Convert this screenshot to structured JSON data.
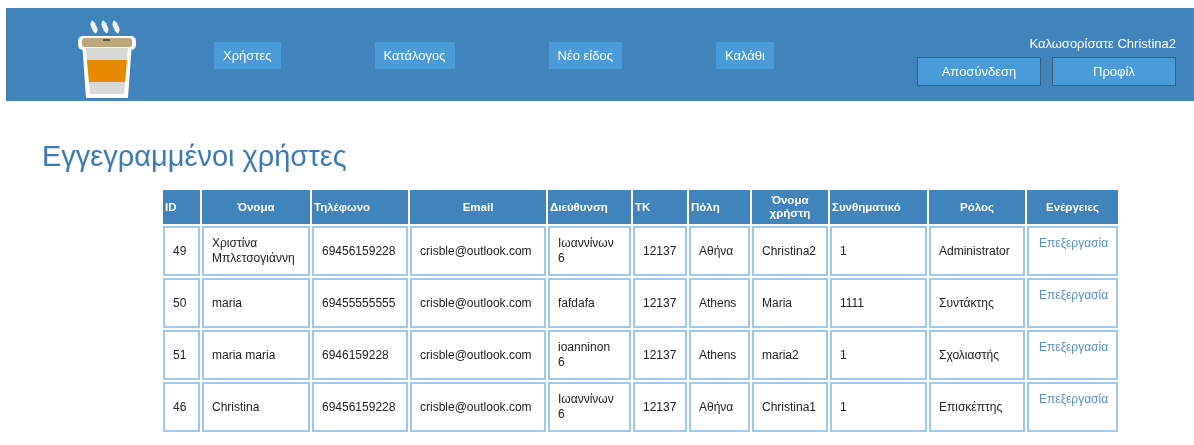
{
  "header": {
    "nav": [
      "Χρήστες",
      "Κατάλογος",
      "Νέο είδος",
      "Καλάθι"
    ],
    "welcome": "Καλωσορίσατε Christina2",
    "buttons": [
      "Αποσύνδεση",
      "Προφίλ"
    ]
  },
  "page_title": "Εγγεγραμμένοι χρήστες",
  "table": {
    "columns": [
      "ID",
      "Όνομα",
      "Τηλέφωνο",
      "Email",
      "Διεύθυνση",
      "ΤΚ",
      "Πόλη",
      "Όνομα χρήστη",
      "Συνθηματικό",
      "Ρόλος",
      "Ενέργειες"
    ],
    "rows": [
      {
        "cells": [
          "49",
          "Χριστίνα Μπλετσογιάννη",
          "69456159228",
          "crisble@outlook.com",
          "Ιωαννίνων 6",
          "12137",
          "Αθήνα",
          "Christina2",
          "1",
          "Administrator"
        ],
        "action": "Επεξεργασία"
      },
      {
        "cells": [
          "50",
          "maria",
          "69455555555",
          "crisble@outlook.com",
          "fafdafa",
          "12137",
          "Athens",
          "Maria",
          "1111",
          "Συντάκτης"
        ],
        "action": "Επεξεργασία"
      },
      {
        "cells": [
          "51",
          "maria maria",
          "6946159228",
          "crisble@outlook.com",
          "ioanninon 6",
          "12137",
          "Athens",
          "maria2",
          "1",
          "Σχολιαστής"
        ],
        "action": "Επεξεργασία"
      },
      {
        "cells": [
          "46",
          "Christina",
          "69456159228",
          "crisble@outlook.com",
          "Ιωαννίνων 6",
          "12137",
          "Αθήνα",
          "Christina1",
          "1",
          "Επισκέπτης"
        ],
        "action": "Επεξεργασία"
      }
    ]
  }
}
